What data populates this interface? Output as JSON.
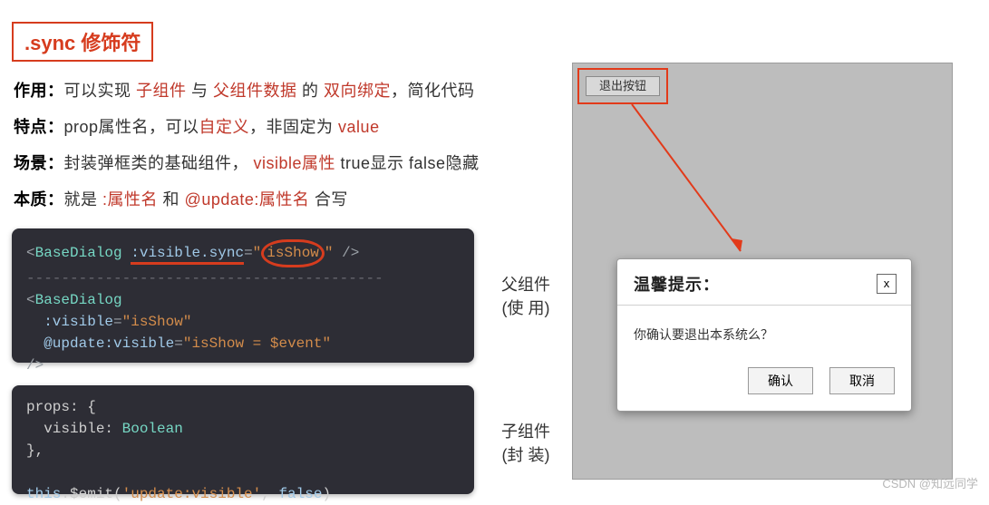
{
  "title": ".sync 修饰符",
  "lines": {
    "l1_label": "作用：",
    "l1_a": "可以实现 ",
    "l1_child": "子组件",
    "l1_b": " 与 ",
    "l1_parent": "父组件数据",
    "l1_c": " 的 ",
    "l1_bind": "双向绑定",
    "l1_d": "，简化代码",
    "l2_label": "特点：",
    "l2_a": "prop属性名，可以",
    "l2_custom": "自定义",
    "l2_b": "，非固定为 ",
    "l2_value": "value",
    "l3_label": "场景：",
    "l3_a": "封装弹框类的基础组件，",
    "l3_visible": " visible属性",
    "l3_b": " true显示 false隐藏",
    "l4_label": "本质：",
    "l4_a": "就是 ",
    "l4_attr": ":属性名",
    "l4_b": " 和 ",
    "l4_update": "@update:属性名",
    "l4_c": " 合写"
  },
  "code1": {
    "tag": "BaseDialog",
    "attr1_name": ":visible.sync",
    "attr1_eq": "=",
    "attr1_val_q1": "\"",
    "attr1_val": "isShow",
    "attr1_val_q2": "\"",
    "dash": "-----------------------------------------",
    "attr2_name": ":visible",
    "attr2_val": "\"isShow\"",
    "attr3_name": "@update:visible",
    "attr3_val": "\"isShow = $event\""
  },
  "code2": {
    "line1a": "props: {",
    "line2a": "  visible: ",
    "line2b": "Boolean",
    "line3a": "},",
    "line5a": "this",
    "line5b": ".$emit(",
    "line5c": "'update:visible'",
    "line5d": ", ",
    "line5e": "false",
    "line5f": ")"
  },
  "side": {
    "parent_a": "父组件",
    "parent_b": "(使   用)",
    "child_a": "子组件",
    "child_b": "(封   装)"
  },
  "ui": {
    "logout": "退出按钮",
    "dialog_title": "温馨提示：",
    "close": "x",
    "body": "你确认要退出本系统么？",
    "confirm": "确认",
    "cancel": "取消"
  },
  "watermark": "CSDN @知远同学"
}
